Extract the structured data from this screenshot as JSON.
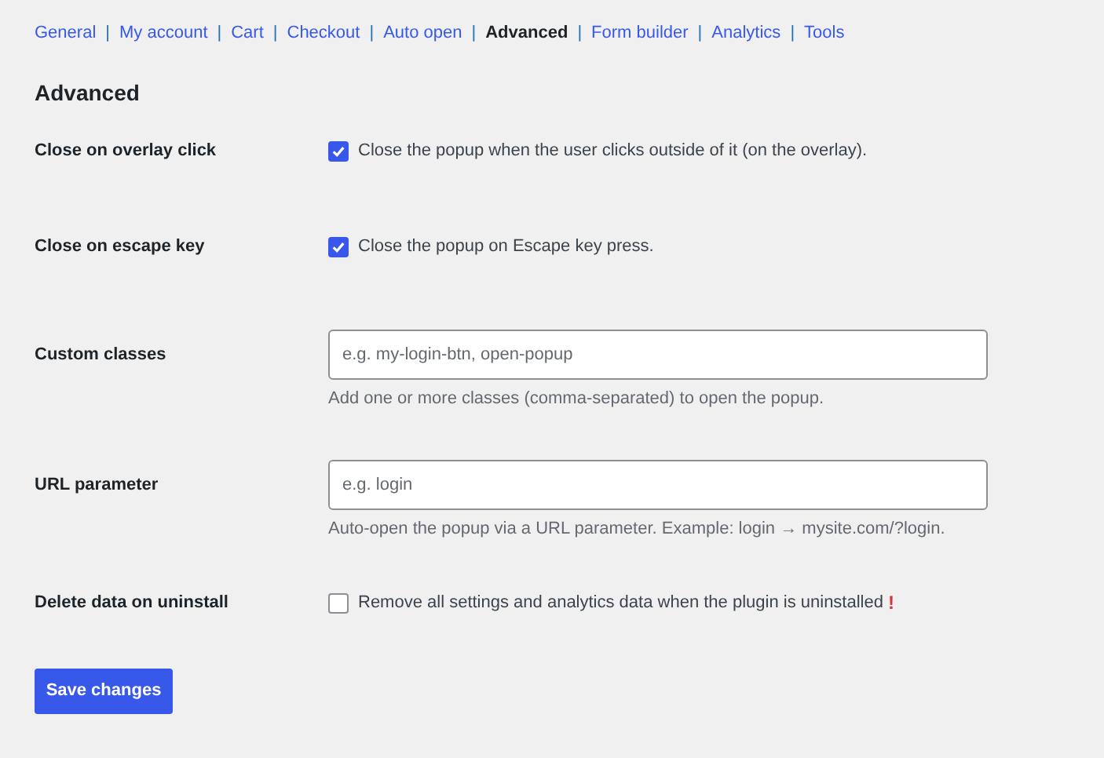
{
  "tabs": [
    {
      "label": "General",
      "selected": false
    },
    {
      "label": "My account",
      "selected": false
    },
    {
      "label": "Cart",
      "selected": false
    },
    {
      "label": "Checkout",
      "selected": false
    },
    {
      "label": "Auto open",
      "selected": false
    },
    {
      "label": "Advanced",
      "selected": true
    },
    {
      "label": "Form builder",
      "selected": false
    },
    {
      "label": "Analytics",
      "selected": false
    },
    {
      "label": "Tools",
      "selected": false
    }
  ],
  "separator": "|",
  "heading": "Advanced",
  "settings": [
    {
      "kind": "checkbox",
      "label": "Close on overlay click",
      "checked": true,
      "text": "Close the popup when the user clicks outside of it (on the overlay)."
    },
    {
      "kind": "checkbox",
      "label": "Close on escape key",
      "checked": true,
      "text": "Close the popup on Escape key press."
    },
    {
      "kind": "text",
      "label": "Custom classes",
      "placeholder": "e.g. my-login-btn, open-popup",
      "description": "Add one or more classes (comma-separated) to open the popup."
    },
    {
      "kind": "text",
      "label": "URL parameter",
      "placeholder": "e.g. login",
      "description": "Auto-open the popup via a URL parameter. Example: login → mysite.com/?login."
    },
    {
      "kind": "checkbox",
      "label": "Delete data on uninstall",
      "checked": false,
      "text": "Remove all settings and analytics data when the plugin is uninstalled",
      "warning": "!"
    }
  ],
  "save_button": "Save changes"
}
